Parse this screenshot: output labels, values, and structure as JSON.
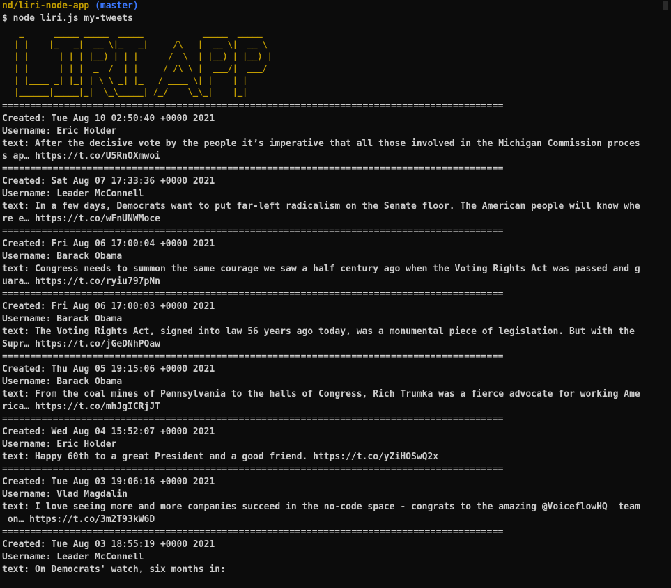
{
  "prompt": {
    "path": "nd/liri-node-app",
    "branch": "(master)",
    "command": "$ node liri.js my-tweets"
  },
  "banner": {
    "ascii": "  _      _____ _____  _____            _____  _____  \n | |    |_   _|  __ \\|_   _|     /\\   |  __ \\|  __ \\ \n | |      | | | |__) | | |      /  \\  | |__) | |__) |\n | |      | | |  _  /  | |     / /\\ \\ |  ___/|  ___/ \n | |____ _| |_| | \\ \\ _| |_   / ____ \\| |    | |     \n |______|_____|_|  \\_\\_____| /_/    \\_\\_|    |_|     "
  },
  "separator": "=========================================================================================",
  "tweets": [
    {
      "created": "Created: Tue Aug 10 02:50:40 +0000 2021",
      "username": "Username: Eric Holder",
      "text1": "text: After the decisive vote by the people it’s imperative that all those involved in the Michigan Commission proces",
      "text2": "s ap… https://t.co/U5RnOXmwoi"
    },
    {
      "created": "Created: Sat Aug 07 17:33:36 +0000 2021",
      "username": "Username: Leader McConnell",
      "text1": "text: In a few days, Democrats want to put far-left radicalism on the Senate floor. The American people will know whe",
      "text2": "re e… https://t.co/wFnUNWMoce"
    },
    {
      "created": "Created: Fri Aug 06 17:00:04 +0000 2021",
      "username": "Username: Barack Obama",
      "text1": "text: Congress needs to summon the same courage we saw a half century ago when the Voting Rights Act was passed and g",
      "text2": "uara… https://t.co/ryiu797pNn"
    },
    {
      "created": "Created: Fri Aug 06 17:00:03 +0000 2021",
      "username": "Username: Barack Obama",
      "text1": "text: The Voting Rights Act, signed into law 56 years ago today, was a monumental piece of legislation. But with the",
      "text2": "Supr… https://t.co/jGeDNhPQaw"
    },
    {
      "created": "Created: Thu Aug 05 19:15:06 +0000 2021",
      "username": "Username: Barack Obama",
      "text1": "text: From the coal mines of Pennsylvania to the halls of Congress, Rich Trumka was a fierce advocate for working Ame",
      "text2": "rica… https://t.co/mhJgICRjJT"
    },
    {
      "created": "Created: Wed Aug 04 15:52:07 +0000 2021",
      "username": "Username: Eric Holder",
      "text1": "text: Happy 60th to a great President and a good friend. https://t.co/yZiHOSwQ2x",
      "text2": ""
    },
    {
      "created": "Created: Tue Aug 03 19:06:16 +0000 2021",
      "username": "Username: Vlad Magdalin",
      "text1": "text: I love seeing more and more companies succeed in the no-code space - congrats to the amazing @VoiceflowHQ  team",
      "text2": " on… https://t.co/3m2T93kW6D"
    },
    {
      "created": "Created: Tue Aug 03 18:55:19 +0000 2021",
      "username": "Username: Leader McConnell",
      "text1": "text: On Democrats' watch, six months in:",
      "text2": ""
    }
  ]
}
